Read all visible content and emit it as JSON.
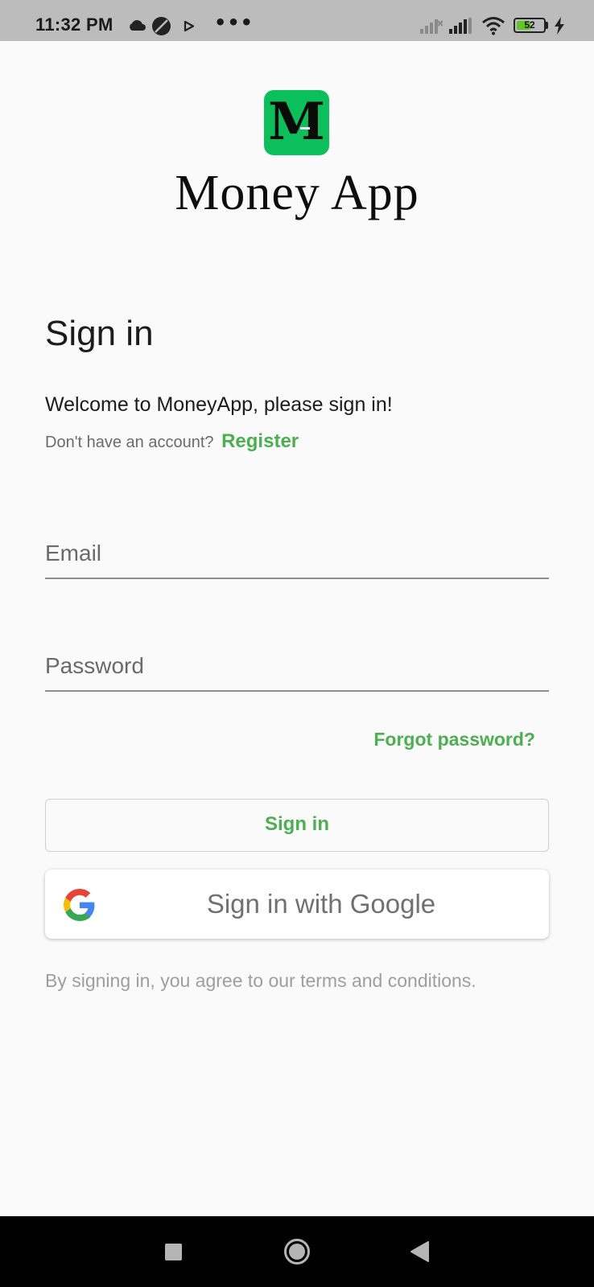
{
  "status_bar": {
    "time": "11:32 PM",
    "icons": [
      "cloud-icon",
      "no-disturb-icon",
      "play-icon",
      "more-dots-icon",
      "signal-off-icon",
      "signal-icon",
      "wifi-icon",
      "battery-icon",
      "charging-icon"
    ],
    "battery_level": "52",
    "more": "•••"
  },
  "logo": {
    "letter": "M",
    "app_name": "Money App",
    "accent": "#0bbf5a"
  },
  "signin": {
    "title": "Sign in",
    "welcome": "Welcome to MoneyApp, please sign in!",
    "no_account": "Don't have an account?",
    "register": "Register",
    "email_placeholder": "Email",
    "password_placeholder": "Password",
    "forgot": "Forgot password?",
    "signin_button": "Sign in",
    "google_button": "Sign in with Google",
    "terms": "By signing in, you agree to our terms and conditions.",
    "accent": "#4caf50"
  },
  "nav": {
    "icons": [
      "recents-icon",
      "home-icon",
      "back-icon"
    ]
  }
}
